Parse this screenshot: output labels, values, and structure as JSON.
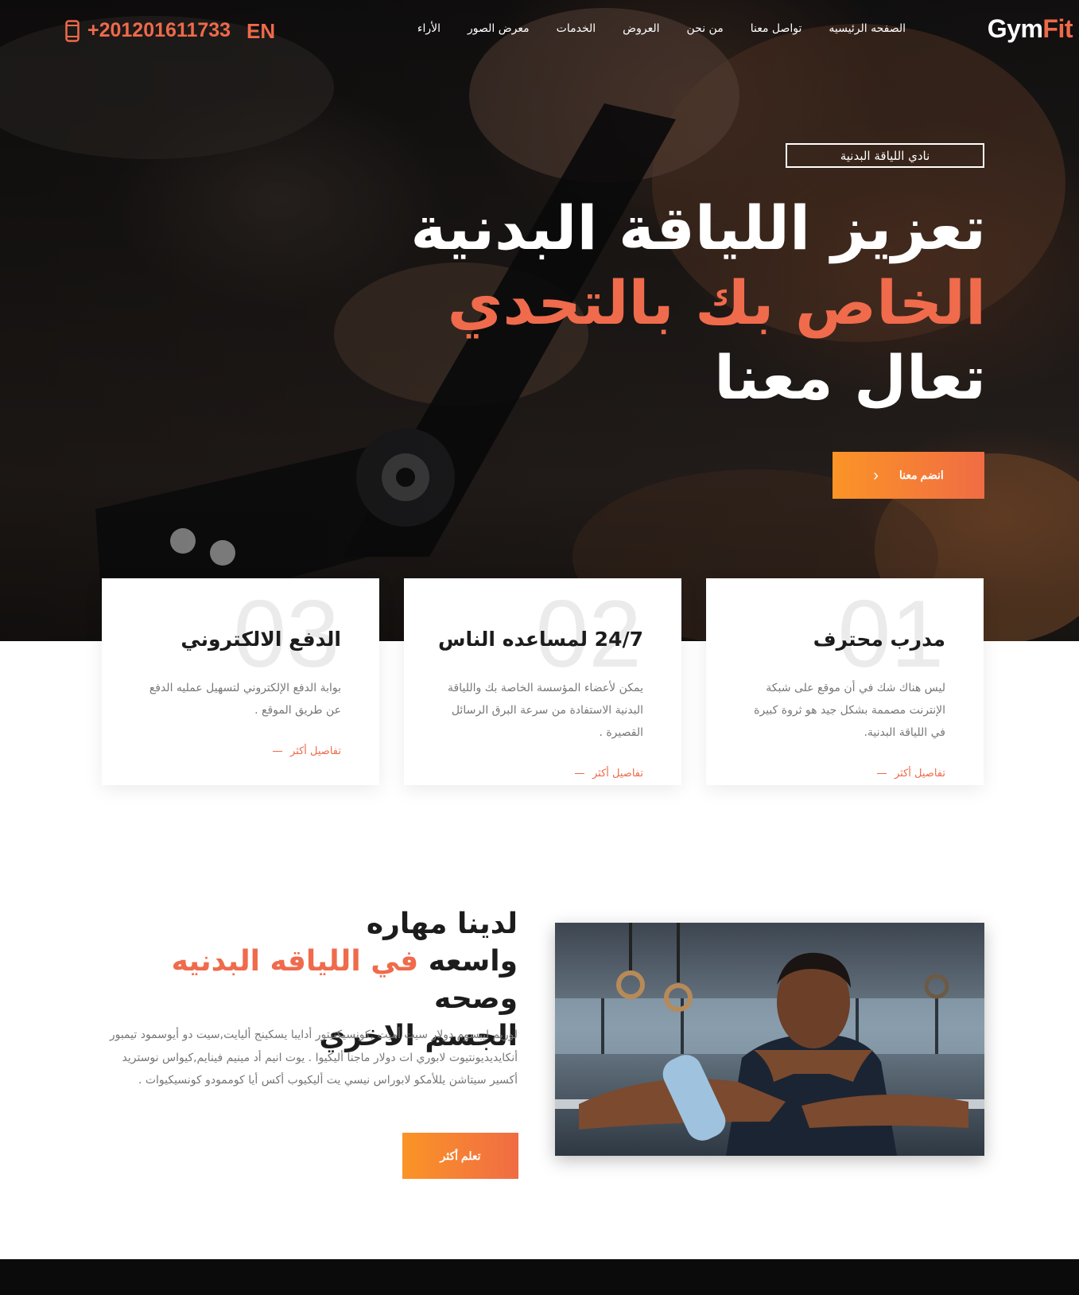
{
  "brand": {
    "logo_part1": "Gym",
    "logo_part2": "Fit"
  },
  "nav": {
    "items": [
      {
        "label": "الصفحه الرئيسيه"
      },
      {
        "label": "تواصل معنا"
      },
      {
        "label": "من نحن"
      },
      {
        "label": "العروض"
      },
      {
        "label": "الخدمات"
      },
      {
        "label": "معرض الصور"
      },
      {
        "label": "الأراء"
      }
    ],
    "lang": "EN",
    "phone": "+201201611733",
    "phone_icon": "mobile-phone-icon"
  },
  "hero": {
    "tag": "نادي اللياقة البدنية",
    "line1": "تعزيز اللياقة البدنية",
    "line2": "الخاص بك بالتحدي",
    "line3": "تعال معنا",
    "button": "انضم معنا",
    "button_icon": "chevron-left-icon"
  },
  "features": [
    {
      "num": "01",
      "title": "مدرب محترف",
      "text": "ليس هناك شك في أن موقع على شبكة الإنترنت مصممة بشكل جيد هو ثروة كبيرة في اللياقة البدنية.",
      "link": "تفاصيل أكثر"
    },
    {
      "num": "02",
      "title": "24/7 لمساعده الناس",
      "text": "يمكن لأعضاء المؤسسة الخاصة بك واللياقة البدنية الاستفادة من سرعة البرق الرسائل القصيرة .",
      "link": "تفاصيل أكثر"
    },
    {
      "num": "03",
      "title": "الدفع الالكتروني",
      "text": "بوابة الدفع الإلكتروني لتسهيل عمليه الدفع عن طريق الموقع .",
      "link": "تفاصيل أكثر"
    }
  ],
  "about": {
    "title_line1": "لدينا مهاره",
    "title_line2_start": "واسعه ",
    "title_line2_accent": "في اللياقه البدنيه",
    "title_line2_end": " وصحه",
    "title_line3": "الجسم الاخري",
    "text": "لوريم ايبسوم دولار سيت أميت ,كونسيكتيتور أدايبا يسكينج أليايت,سيت دو أيوسمود تيمبور أنكايديديونتيوت لابوري ات دولار ماجنا أليكيوا . يوت انيم أد مينيم فينايم,كيواس نوستريد أكسير سيتاشن يللأمكو لابوراس نيسي يت أليكيوب أكس أيا كوممودو كونسيكيوات .",
    "button": "تعلم أكثر",
    "image": "gym-athlete-photo"
  },
  "colors": {
    "accent": "#ef6b4c",
    "gradient_start": "#fb9426",
    "gradient_end": "#f06c44",
    "dark": "#141212"
  }
}
